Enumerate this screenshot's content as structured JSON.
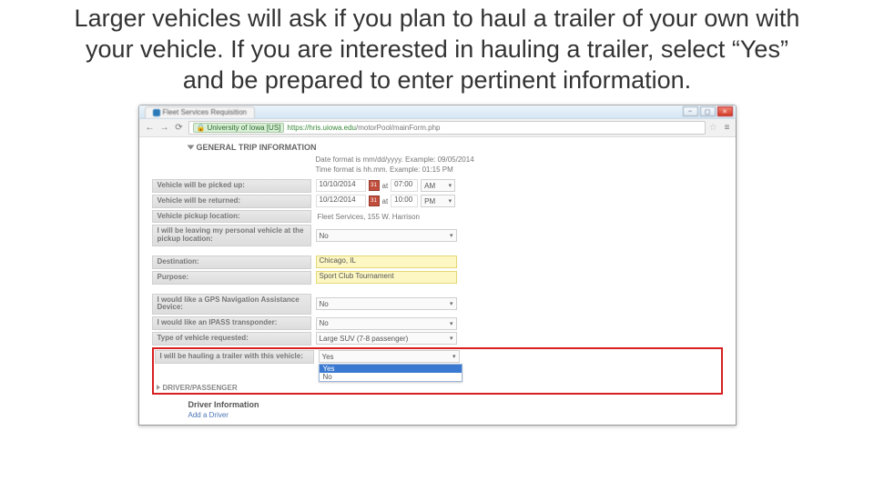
{
  "slide": {
    "title": "Larger vehicles will ask if you plan to haul a trailer of your own with your vehicle. If you are interested in hauling a trailer, select “Yes” and be prepared to enter pertinent information."
  },
  "browser": {
    "tab_title": "Fleet Services Requisition",
    "https_chip": "University of Iowa [US]",
    "url_host": "https://hris.uiowa.edu",
    "url_path": "/motorPool/mainForm.php",
    "win_min": "–",
    "win_max": "▢",
    "win_close": "✕",
    "back": "←",
    "fwd": "→",
    "reload": "⟳",
    "star": "☆",
    "menu": "≡"
  },
  "form": {
    "section_title": "GENERAL TRIP INFORMATION",
    "hint1": "Date format is mm/dd/yyyy. Example: 09/05/2014",
    "hint2": "Time format is hh.mm. Example: 01:15 PM",
    "pickup_label": "Vehicle will be picked up:",
    "pickup_date": "10/10/2014",
    "pickup_at": "at",
    "pickup_time": "07:00",
    "pickup_ampm": "AM",
    "return_label": "Vehicle will be returned:",
    "return_date": "10/12/2014",
    "return_at": "at",
    "return_time": "10:00",
    "return_ampm": "PM",
    "loc_label": "Vehicle pickup location:",
    "loc_value": "Fleet Services, 155 W. Harrison",
    "leave_label": "I will be leaving my personal vehicle at the pickup location:",
    "leave_value": "No",
    "dest_label": "Destination:",
    "dest_value": "Chicago, IL",
    "purpose_label": "Purpose:",
    "purpose_value": "Sport Club Tournament",
    "gps_label": "I would like a GPS Navigation Assistance Device:",
    "gps_value": "No",
    "ipass_label": "I would like an IPASS transponder:",
    "ipass_value": "No",
    "type_label": "Type of vehicle requested:",
    "type_value": "Large SUV (7-8 passenger)",
    "trailer_label": "I will be hauling a trailer with this vehicle:",
    "trailer_value": "Yes",
    "trailer_opt_yes": "Yes",
    "trailer_opt_no": "No",
    "section2_title": "DRIVER/PASSENGER",
    "driver_info": "Driver Information",
    "add_driver": "Add a Driver",
    "cal_glyph": "31"
  }
}
